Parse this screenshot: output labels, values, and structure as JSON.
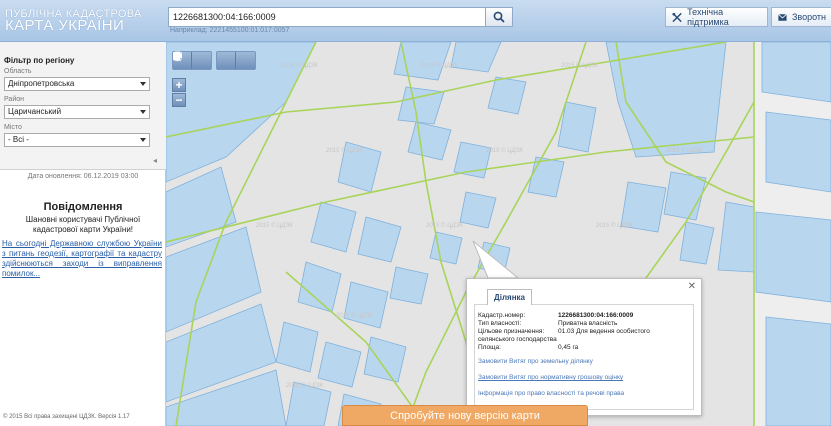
{
  "header": {
    "logo_line1": "ПУБЛІЧНА КАДАСТРОВА",
    "logo_line2": "КАРТА УКРАЇНИ",
    "search_value": "1226681300:04:166:0009",
    "search_hint": "Наприклад: 2221455100:01:017:0057",
    "support_label": "Технічна підтримка",
    "feedback_label": "Зворотн"
  },
  "sidebar": {
    "filter_title": "Фільтр по регіону",
    "region_label": "Область",
    "region_value": "Дніпропетровська",
    "district_label": "Район",
    "district_value": "Царичанський",
    "city_label": "Місто",
    "city_value": "- Всі -",
    "updated": "Дата оновлення: 06.12.2019 03:00",
    "notices_title": "Повідомлення",
    "notices_text": "Шановні користувачі Публічної кадастрової карти України!",
    "notices_link": "На сьогодні Державною службою України з питань геодезії, картографії та кадастру здійснюються заходи із виправлення помилок...",
    "copyright": "© 2015 Всі права захищені ЦДЗК. Версія 1.17"
  },
  "popup": {
    "tab_label": "Ділянка",
    "rows": [
      {
        "k": "Кадастр.номер:",
        "v": "1226681300:04:166:0009"
      },
      {
        "k": "Тип власності:",
        "v": "Приватна власність"
      },
      {
        "k": "Цільове призначення:",
        "v": "01.03 Для ведення особистого"
      },
      {
        "k": "",
        "v": "селянського господарства"
      },
      {
        "k": "Площа:",
        "v": "0,45 га"
      }
    ],
    "links": [
      "Замовити Витяг про земельну ділянку",
      "Замовити Витяг про нормативну грошову оцінку",
      "Інформація про право власності та речові права"
    ]
  },
  "try_new": "Спробуйте нову версію карти",
  "watermark": "2015 © ЦДЗК",
  "colors": {
    "parcel_fill": "#b9d6ef",
    "parcel_stroke": "#7fb1dc",
    "road": "#a8d45a",
    "accent": "#f0a965"
  },
  "icons": [
    "search-icon",
    "tools-icon",
    "mail-icon",
    "measure-line-icon",
    "measure-area-icon",
    "print-icon",
    "info-pointer-icon"
  ]
}
